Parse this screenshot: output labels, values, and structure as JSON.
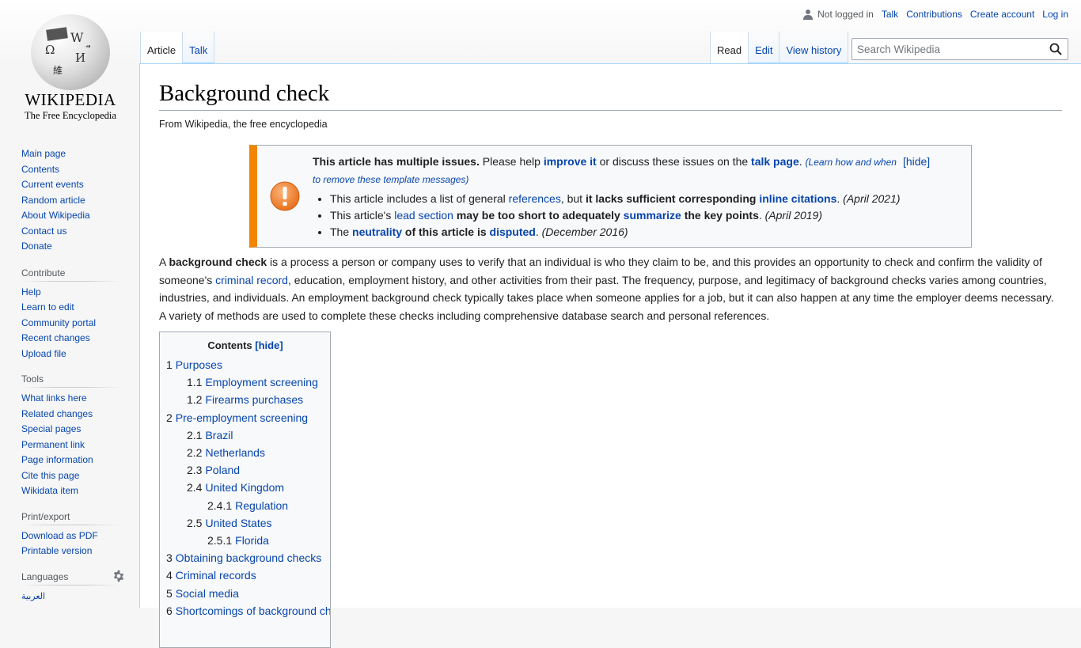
{
  "logo": {
    "wordmark": "Wikipedia",
    "tagline": "The Free Encyclopedia"
  },
  "personal": {
    "status": "Not logged in",
    "links": [
      "Talk",
      "Contributions",
      "Create account",
      "Log in"
    ]
  },
  "tabs": {
    "namespaces": [
      {
        "label": "Article",
        "selected": true
      },
      {
        "label": "Talk",
        "selected": false
      }
    ],
    "views": [
      {
        "label": "Read",
        "selected": true
      },
      {
        "label": "Edit",
        "selected": false
      },
      {
        "label": "View history",
        "selected": false
      }
    ]
  },
  "search": {
    "placeholder": "Search Wikipedia",
    "value": ""
  },
  "sidebar": {
    "navigation": [
      "Main page",
      "Contents",
      "Current events",
      "Random article",
      "About Wikipedia",
      "Contact us",
      "Donate"
    ],
    "contribute": {
      "heading": "Contribute",
      "items": [
        "Help",
        "Learn to edit",
        "Community portal",
        "Recent changes",
        "Upload file"
      ]
    },
    "tools": {
      "heading": "Tools",
      "items": [
        "What links here",
        "Related changes",
        "Special pages",
        "Permanent link",
        "Page information",
        "Cite this page",
        "Wikidata item"
      ]
    },
    "print": {
      "heading": "Print/export",
      "items": [
        "Download as PDF",
        "Printable version"
      ]
    },
    "languages": {
      "heading": "Languages",
      "items": [
        "العربية"
      ]
    }
  },
  "article": {
    "title": "Background check",
    "tagline": "From Wikipedia, the free encyclopedia",
    "ambox": {
      "heading": "This article has multiple issues.",
      "intro_pre": " Please help ",
      "improve_link": "improve it",
      "intro_mid": " or discuss these issues on the ",
      "talk_link": "talk page",
      "intro_post": ". ",
      "learn_text": "(Learn how and when",
      "hide": "[hide]",
      "learn_text2": "to remove these template messages)",
      "issues": [
        {
          "t1": "This article includes a list of general ",
          "l1": "references",
          "t2": ", but ",
          "b1": "it lacks sufficient corresponding ",
          "l2": "inline citations",
          "t3": ". ",
          "date": "(April 2021)"
        },
        {
          "t1": "This article's ",
          "l1": "lead section",
          "b1": " may be too short to adequately ",
          "l2": "summarize",
          "b2": " the key points",
          "t3": ". ",
          "date": "(April 2019)"
        },
        {
          "t1": "The ",
          "l1": "neutrality",
          "b1": " of this article is ",
          "l2": "disputed",
          "t3": ". ",
          "date": "(December 2016)"
        }
      ]
    },
    "lead": {
      "p1": "A ",
      "bold": "background check",
      "p2": " is a process a person or company uses to verify that an individual is who they claim to be, and this provides an opportunity to check and confirm the validity of someone's ",
      "link": "criminal record",
      "p3": ", education, employment history, and other activities from their past. The frequency, purpose, and legitimacy of background checks varies among countries, industries, and individuals. An employment background check typically takes place when someone applies for a job, but it can also happen at any time the employer deems necessary. A variety of methods are used to complete these checks including comprehensive database search and personal references."
    },
    "toc": {
      "title": "Contents",
      "hide": "[hide]",
      "items": [
        {
          "num": "1",
          "label": "Purposes",
          "level": 1
        },
        {
          "num": "1.1",
          "label": "Employment screening",
          "level": 2
        },
        {
          "num": "1.2",
          "label": "Firearms purchases",
          "level": 2
        },
        {
          "num": "2",
          "label": "Pre-employment screening",
          "level": 1
        },
        {
          "num": "2.1",
          "label": "Brazil",
          "level": 2
        },
        {
          "num": "2.2",
          "label": "Netherlands",
          "level": 2
        },
        {
          "num": "2.3",
          "label": "Poland",
          "level": 2
        },
        {
          "num": "2.4",
          "label": "United Kingdom",
          "level": 2
        },
        {
          "num": "2.4.1",
          "label": "Regulation",
          "level": 3
        },
        {
          "num": "2.5",
          "label": "United States",
          "level": 2
        },
        {
          "num": "2.5.1",
          "label": "Florida",
          "level": 3
        },
        {
          "num": "3",
          "label": "Obtaining background checks",
          "level": 1
        },
        {
          "num": "4",
          "label": "Criminal records",
          "level": 1
        },
        {
          "num": "5",
          "label": "Social media",
          "level": 1
        },
        {
          "num": "6",
          "label": "Shortcomings of background checks",
          "level": 1
        }
      ]
    }
  },
  "colors": {
    "link": "#0645ad",
    "ambox_accent": "#f28500",
    "border": "#a2a9b1",
    "tab_border": "#a7d7f9"
  }
}
